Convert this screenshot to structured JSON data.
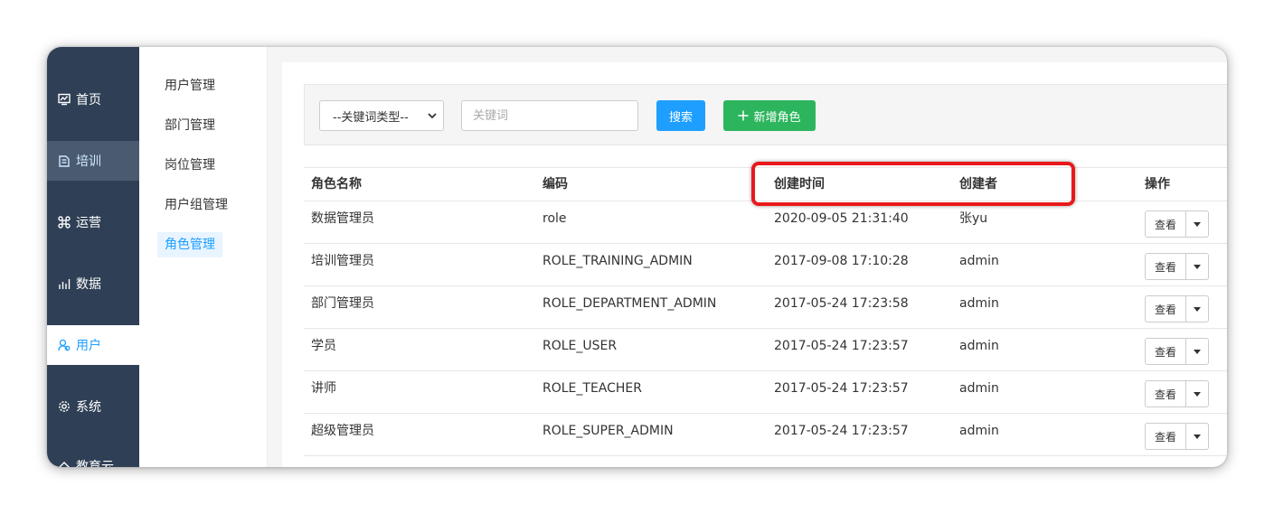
{
  "nav": {
    "items": [
      {
        "label": "首页",
        "icon": "chart-icon"
      },
      {
        "label": "培训",
        "icon": "book-icon"
      },
      {
        "label": "运营",
        "icon": "command-icon"
      },
      {
        "label": "数据",
        "icon": "bar-chart-icon"
      },
      {
        "label": "用户",
        "icon": "users-icon"
      },
      {
        "label": "系统",
        "icon": "gear-icon"
      },
      {
        "label": "教育云",
        "icon": "cloud-icon"
      }
    ]
  },
  "submenu": {
    "items": [
      {
        "label": "用户管理"
      },
      {
        "label": "部门管理"
      },
      {
        "label": "岗位管理"
      },
      {
        "label": "用户组管理"
      },
      {
        "label": "角色管理"
      }
    ]
  },
  "search": {
    "select_value": "--关键词类型--",
    "keyword_placeholder": "关键词",
    "search_label": "搜索",
    "add_label": "新增角色"
  },
  "table": {
    "headers": {
      "name": "角色名称",
      "code": "编码",
      "created_at": "创建时间",
      "creator": "创建者",
      "actions": "操作"
    },
    "rows": [
      {
        "name": "数据管理员",
        "code": "role",
        "created_at": "2020-09-05 21:31:40",
        "creator": "张yu"
      },
      {
        "name": "培训管理员",
        "code": "ROLE_TRAINING_ADMIN",
        "created_at": "2017-09-08 17:10:28",
        "creator": "admin"
      },
      {
        "name": "部门管理员",
        "code": "ROLE_DEPARTMENT_ADMIN",
        "created_at": "2017-05-24 17:23:58",
        "creator": "admin"
      },
      {
        "name": "学员",
        "code": "ROLE_USER",
        "created_at": "2017-05-24 17:23:57",
        "creator": "admin"
      },
      {
        "name": "讲师",
        "code": "ROLE_TEACHER",
        "created_at": "2017-05-24 17:23:57",
        "creator": "admin"
      },
      {
        "name": "超级管理员",
        "code": "ROLE_SUPER_ADMIN",
        "created_at": "2017-05-24 17:23:57",
        "creator": "admin"
      }
    ],
    "view_label": "查看"
  },
  "colors": {
    "nav_bg": "#2f4056",
    "accent": "#1e9fff",
    "add_green": "#2db55d",
    "highlight_red": "#e8191c"
  }
}
